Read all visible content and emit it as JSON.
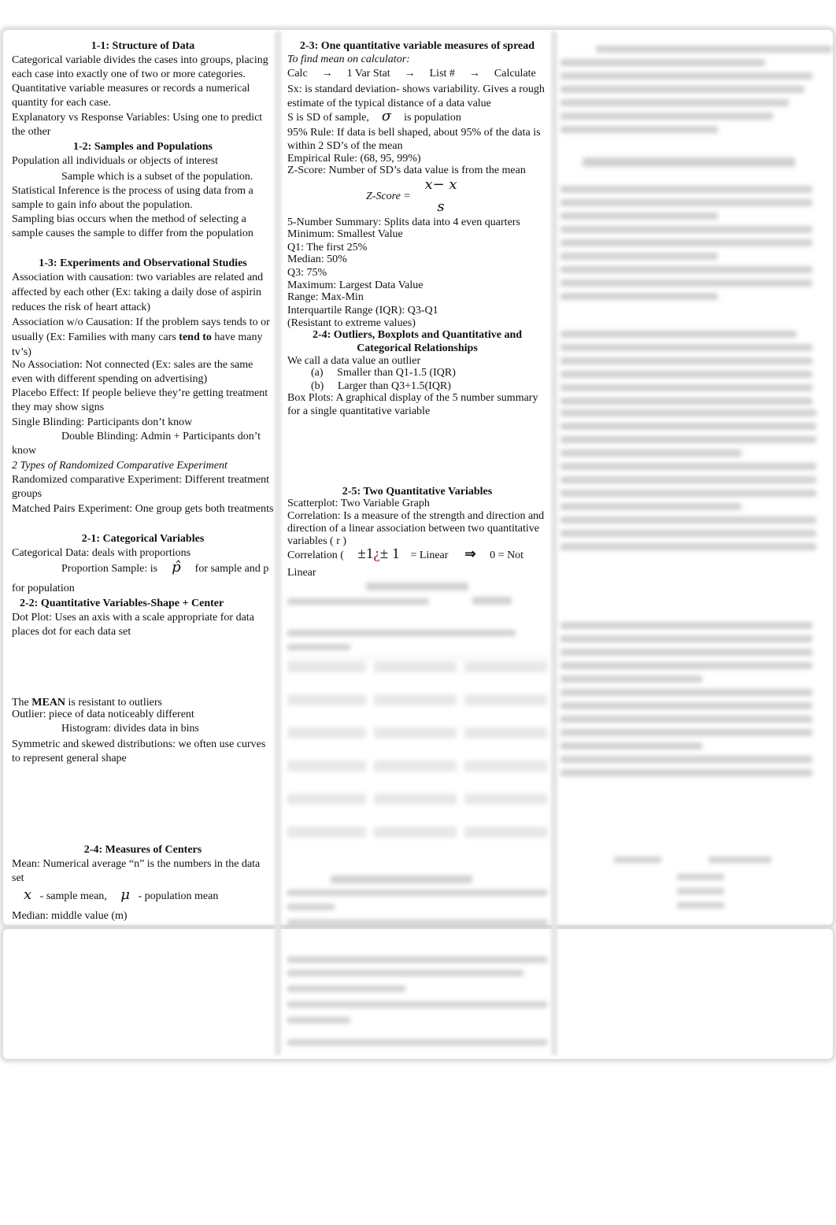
{
  "col1": {
    "h11": "1-1: Structure of Data",
    "p_cat": "Categorical variable divides the cases into groups, placing each case into exactly one of two or more categories.",
    "p_quant": "Quantitative variable measures or records a numerical quantity for each case.",
    "p_expl": "Explanatory vs Response Variables: Using one to predict the other",
    "h12": "1-2: Samples and Populations",
    "p_pop": "Population all individuals or objects of interest",
    "p_sample": "Sample which is a subset of the population.",
    "p_inf": "Statistical Inference is the process of using data from a sample to gain info about the population.",
    "p_bias": "Sampling bias occurs when the method of selecting a sample causes the sample to differ from the population",
    "h13": "1-3: Experiments and Observational Studies",
    "p_caus": "Association with causation: two variables are related and affected by each other (Ex: taking a daily dose of aspirin reduces the risk of heart attack)",
    "p_wo_a": "Association w/o Causation: If the problem says tends to or usually (Ex: Families with many cars ",
    "p_wo_bold": "tend to",
    "p_wo_b": " have many tv’s)",
    "p_noassoc": "No Association: Not connected (Ex: sales are the same even with different spending on advertising)",
    "p_placebo": "Placebo Effect: If people believe they’re getting treatment they may show signs",
    "p_single": "Single Blinding: Participants don’t know",
    "p_double": "Double Blinding: Admin + Participants don’t know",
    "p_types": "2 Types of Randomized Comparative Experiment",
    "p_rand": "Randomized comparative Experiment: Different treatment groups",
    "p_matched": "Matched Pairs Experiment: One group gets both treatments",
    "h21": "2-1: Categorical Variables",
    "p_catdata": "Categorical Data:  deals with proportions",
    "p_prop_a": "Proportion Sample: is",
    "p_prop_sym": "p̂",
    "p_prop_b": "for sample and p",
    "p_prop_c": "for population",
    "h22": "2-2: Quantitative Variables-Shape + Center",
    "p_dot": "Dot Plot: Uses an axis with a scale appropriate for data places dot for each data set",
    "p_mean_a": "The ",
    "p_mean_bold": "MEAN",
    "p_mean_b": " is resistant to outliers",
    "p_outlier": "Outlier: piece of data noticeably different",
    "p_hist": "Histogram:  divides data in bins",
    "p_sym": "Symmetric and skewed distributions: we often use curves to represent general shape",
    "h24": "2-4: Measures of Centers",
    "p_meandef": "Mean: Numerical average “n” is the numbers in the data set",
    "sym_x": "x",
    "p_xmean": "- sample mean,",
    "sym_mu": "μ",
    "p_mumean": "- population mean",
    "p_median": "Median: middle value (m)"
  },
  "col2": {
    "h23": "2-3: One quantitative variable measures of spread",
    "p_calc_it": "To find mean on calculator:",
    "calc_steps": [
      "Calc",
      "1 Var Stat",
      "List #",
      "Calculate"
    ],
    "arrow": "→",
    "p_sx": "Sx: is standard deviation- shows variability. Gives a rough estimate of the typical distance of a data value",
    "p_sd_a": "S is SD of sample,",
    "sym_sigma": "σ",
    "p_sd_b": "is population",
    "p_95": "95% Rule: If data is bell shaped, about 95% of the data is within 2 SD’s of the mean",
    "p_emp": "Empirical Rule: (68, 95, 99%)",
    "p_z": "Z-Score:  Number of SD’s data value is from the mean",
    "z_label": "Z-Score =",
    "z_num": "x− x",
    "z_den": "s",
    "p_5num": "5-Number Summary: Splits data into 4 even quarters",
    "p_min": "Minimum:  Smallest Value",
    "p_q1": "Q1: The first 25%",
    "p_med": "Median: 50%",
    "p_q3": "Q3: 75%",
    "p_max": "Maximum: Largest Data Value",
    "p_range": "Range: Max-Min",
    "p_iqr": "Interquartile Range (IQR): Q3-Q1",
    "p_resist": "(Resistant to extreme values)",
    "h24b": "2-4: Outliers, Boxplots and Quantitative and Categorical Relationships",
    "p_call": "We call a data value an outlier",
    "p_a_lbl": "(a)",
    "p_a": "Smaller than Q1-1.5 (IQR)",
    "p_b_lbl": "(b)",
    "p_b": "Larger than Q3+1.5(IQR)",
    "p_box": "Box Plots: A graphical display of the 5 number summary for a single quantitative variable",
    "h25": "2-5: Two Quantitative Variables",
    "p_scatter": "Scatterplot: Two Variable Graph",
    "p_corr": "Correlation: Is a measure of the strength and direction and direction of a linear association between two quantitative variables ( r )",
    "corr_a": "Correlation (",
    "corr_pm1": "±1",
    "corr_q": "¿",
    "corr_pm2": "± 1",
    "corr_lin": "= Linear",
    "corr_implies": "⇒",
    "corr_not": "0 = Not",
    "corr_linear": "Linear"
  },
  "colors": {
    "text": "#111111",
    "accent_red": "#a01010",
    "blur": "#bdbdbd"
  }
}
